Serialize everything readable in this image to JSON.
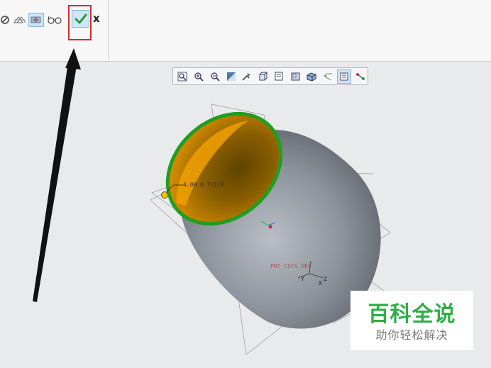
{
  "ribbon": {
    "tools": [
      {
        "name": "pause-icon",
        "glyph": "⊘"
      },
      {
        "name": "glasses-icon",
        "glyph": "⌾⌾"
      }
    ],
    "cancel_label": "x"
  },
  "view_toolbar": {
    "icons": [
      "zoom-fit-icon",
      "zoom-in-icon",
      "zoom-out-icon",
      "repaint-icon",
      "view-orientation-icon",
      "display-style-icon",
      "saved-views-icon",
      "view-manager-icon",
      "perspective-icon",
      "datum-display-icon",
      "annotation-display-icon",
      "spin-center-icon"
    ]
  },
  "model": {
    "dimension_label": "4.00 0.THICK",
    "csys_label": "PRT_CSYS_DEF",
    "axis_y": "Y",
    "axis_x": "X",
    "axis_z": "Z"
  },
  "watermark": {
    "title": "百科全说",
    "subtitle": "助你轻松解决"
  },
  "colors": {
    "body": "#8a9099",
    "inner": "#e08f00",
    "rim": "#1f9e22",
    "highlight": "#d12d2d",
    "watermark_green": "#2eae46"
  }
}
